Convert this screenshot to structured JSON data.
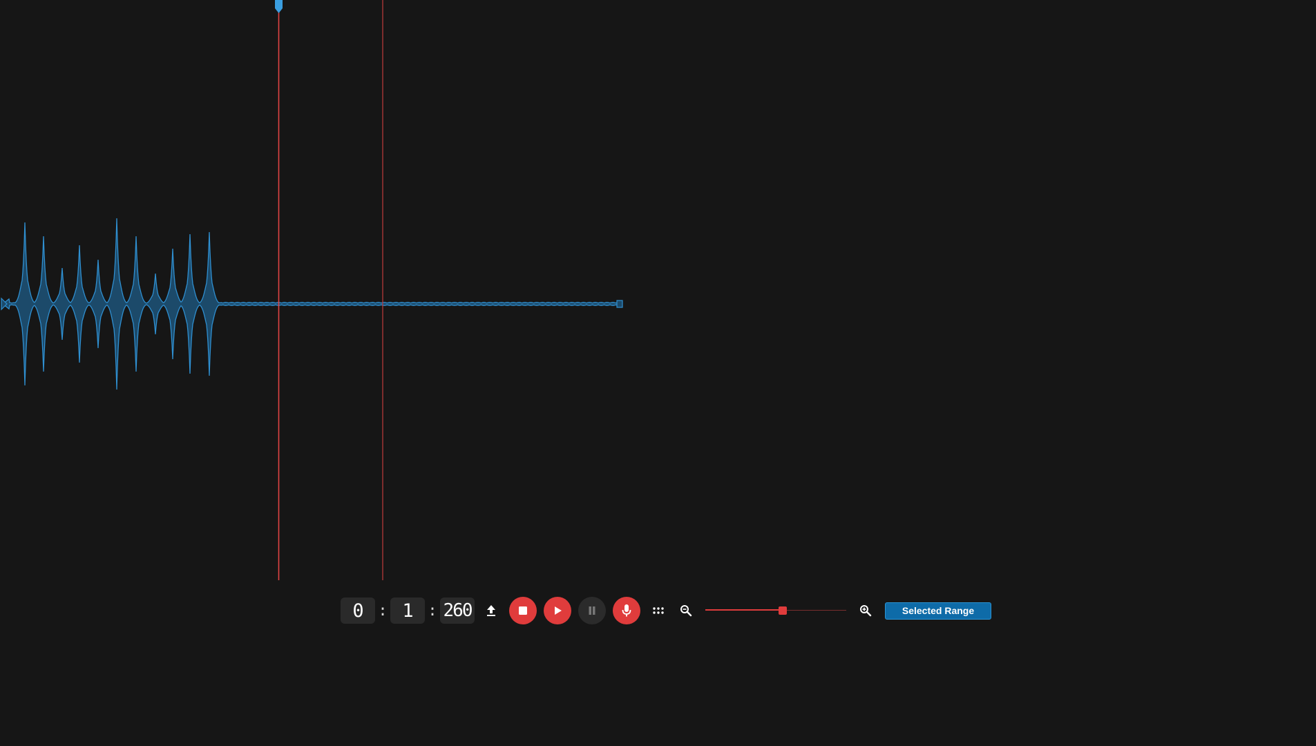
{
  "colors": {
    "background": "#161616",
    "waveform_stroke": "#2f8fd0",
    "waveform_fill": "#1c4a6a",
    "cursor_line": "#e04444",
    "accent_red": "#e03c3c",
    "range_button": "#0e6ba8"
  },
  "timecode": {
    "minutes": "0",
    "seconds": "1",
    "milliseconds": "260",
    "separator": ":"
  },
  "toolbar": {
    "upload_icon": "upload-icon",
    "stop_icon": "stop-icon",
    "play_icon": "play-icon",
    "pause_icon": "pause-icon",
    "record_icon": "microphone-icon",
    "more_icon": "dots-grid-icon",
    "zoom_out_icon": "zoom-out-icon",
    "zoom_in_icon": "zoom-in-icon",
    "zoom_level": 0.55,
    "selected_range_label": "Selected Range"
  }
}
